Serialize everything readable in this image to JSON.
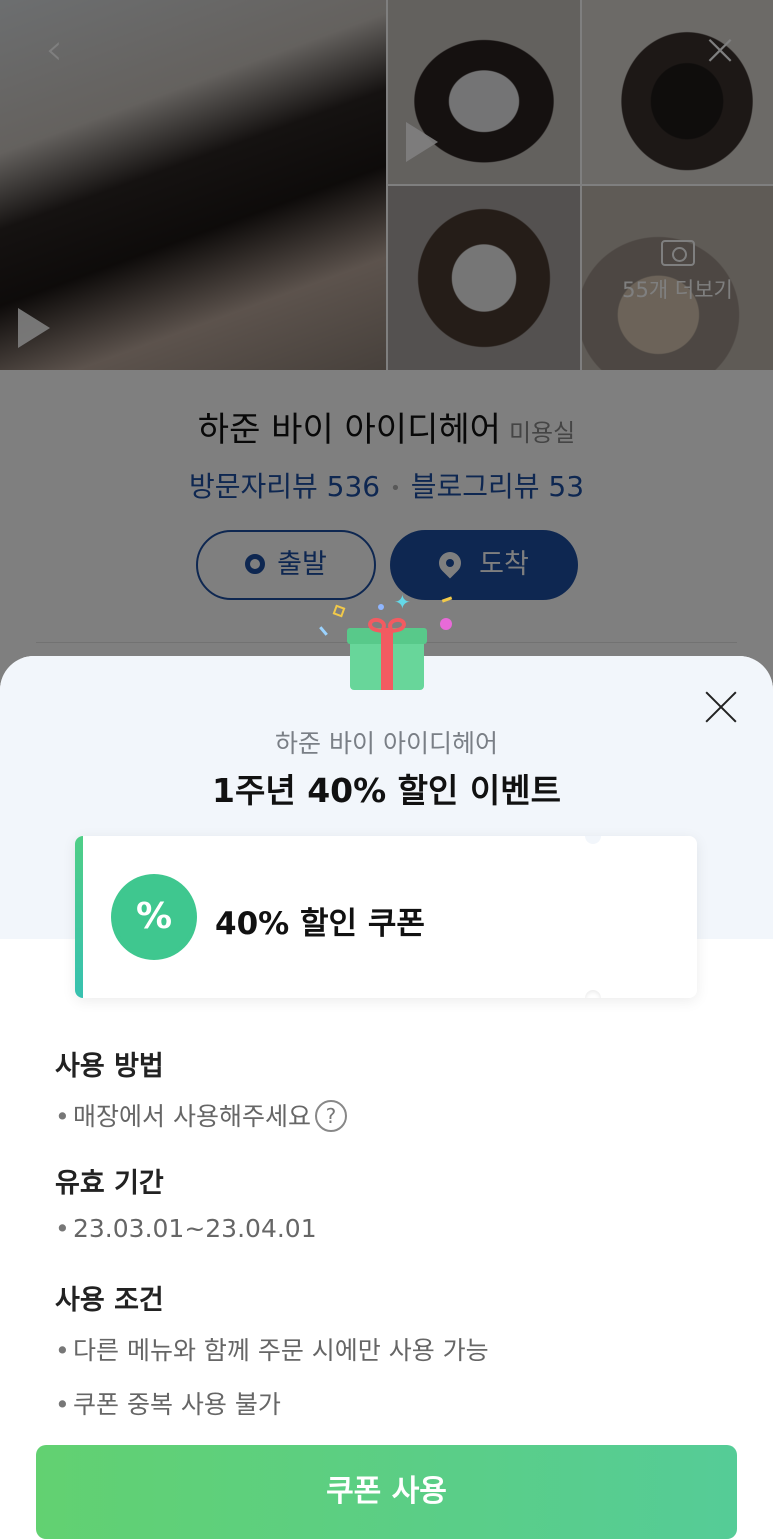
{
  "background": {
    "gallery": {
      "more_photos_label": "55개 더보기"
    },
    "shop": {
      "name": "하준 바이 아이디헤어",
      "category": "미용실",
      "visitor_reviews": "방문자리뷰 536",
      "blog_reviews": "블로그리뷰 53"
    },
    "actions": {
      "depart_label": "출발",
      "arrive_label": "도착"
    }
  },
  "sheet": {
    "shop_name": "하준 바이 아이디헤어",
    "title": "1주년 40% 할인 이벤트",
    "coupon": {
      "badge_symbol": "%",
      "label": "40% 할인 쿠폰"
    },
    "sections": [
      {
        "title": "사용 방법",
        "items": [
          "매장에서 사용해주세요"
        ]
      },
      {
        "title": "유효 기간",
        "items": [
          "23.03.01~23.04.01"
        ]
      },
      {
        "title": "사용 조건",
        "items": [
          "다른 메뉴와 함께 주문 시에만 사용 가능",
          "쿠폰 중복 사용 불가"
        ]
      }
    ],
    "help_symbol": "?",
    "use_button_label": "쿠폰 사용"
  },
  "colors": {
    "brand_blue": "#1d4fa3",
    "coupon_green": "#3fc78f",
    "button_green": "#62d171",
    "sheet_top_bg": "#f2f6fb"
  },
  "icons": [
    "back-icon",
    "close-icon",
    "play-icon",
    "camera-icon",
    "location-ring-icon",
    "pin-icon",
    "gift-icon",
    "percent-badge-icon",
    "help-icon"
  ]
}
